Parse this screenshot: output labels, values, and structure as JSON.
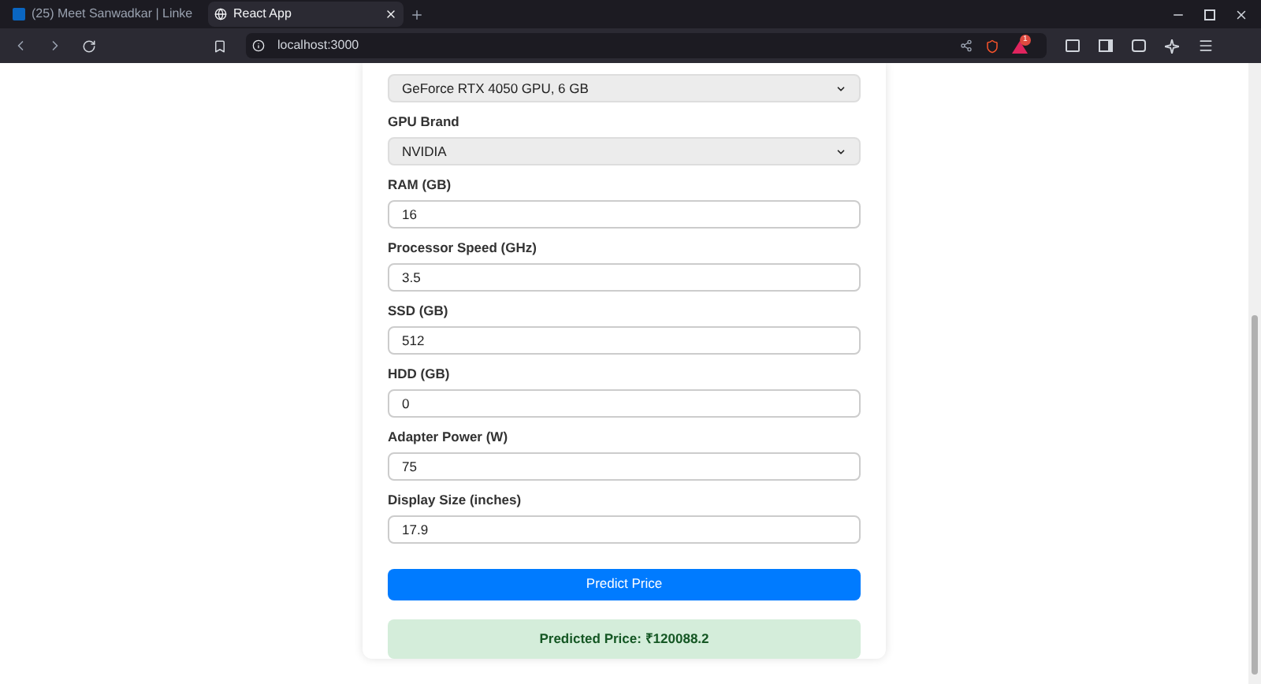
{
  "browser": {
    "tabs": [
      {
        "title": "(25) Meet Sanwadkar | Linke",
        "selected": false
      },
      {
        "title": "React App",
        "selected": true
      }
    ],
    "address": "localhost:3000",
    "notification_count": "1"
  },
  "form": {
    "fields": [
      {
        "kind": "select",
        "value": "GeForce RTX 4050 GPU, 6 GB"
      },
      {
        "kind": "select",
        "label": "GPU Brand",
        "value": "NVIDIA"
      },
      {
        "kind": "input",
        "label": "RAM (GB)",
        "value": "16"
      },
      {
        "kind": "input",
        "label": "Processor Speed (GHz)",
        "value": "3.5"
      },
      {
        "kind": "input",
        "label": "SSD (GB)",
        "value": "512"
      },
      {
        "kind": "input",
        "label": "HDD (GB)",
        "value": "0"
      },
      {
        "kind": "input",
        "label": "Adapter Power (W)",
        "value": "75"
      },
      {
        "kind": "input",
        "label": "Display Size (inches)",
        "value": "17.9"
      }
    ],
    "button": "Predict Price",
    "result": "Predicted Price: ₹120088.2"
  }
}
